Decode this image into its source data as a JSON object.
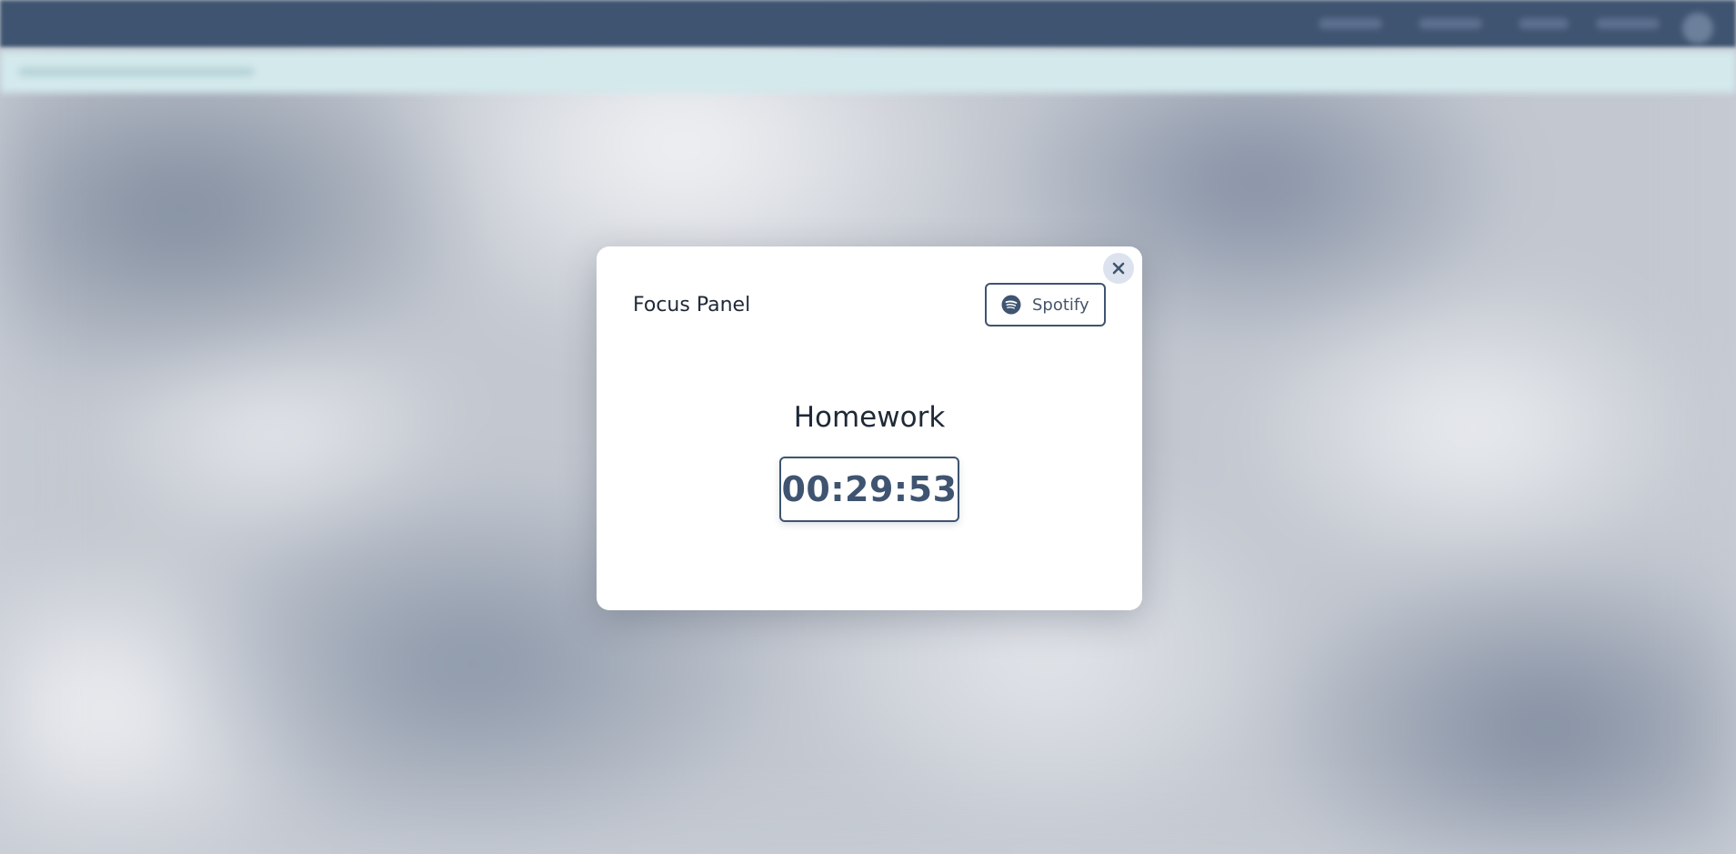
{
  "modal": {
    "title": "Focus Panel",
    "spotify_label": "Spotify",
    "task_title": "Homework",
    "timer_value": "00:29:53"
  },
  "icons": {
    "close": "close-icon",
    "spotify": "spotify-icon"
  },
  "colors": {
    "accent": "#3f5470",
    "topbar": "#3f5470",
    "subbar": "#d3e9ec",
    "close_bg": "#dde3ee",
    "modal_bg": "#ffffff"
  }
}
